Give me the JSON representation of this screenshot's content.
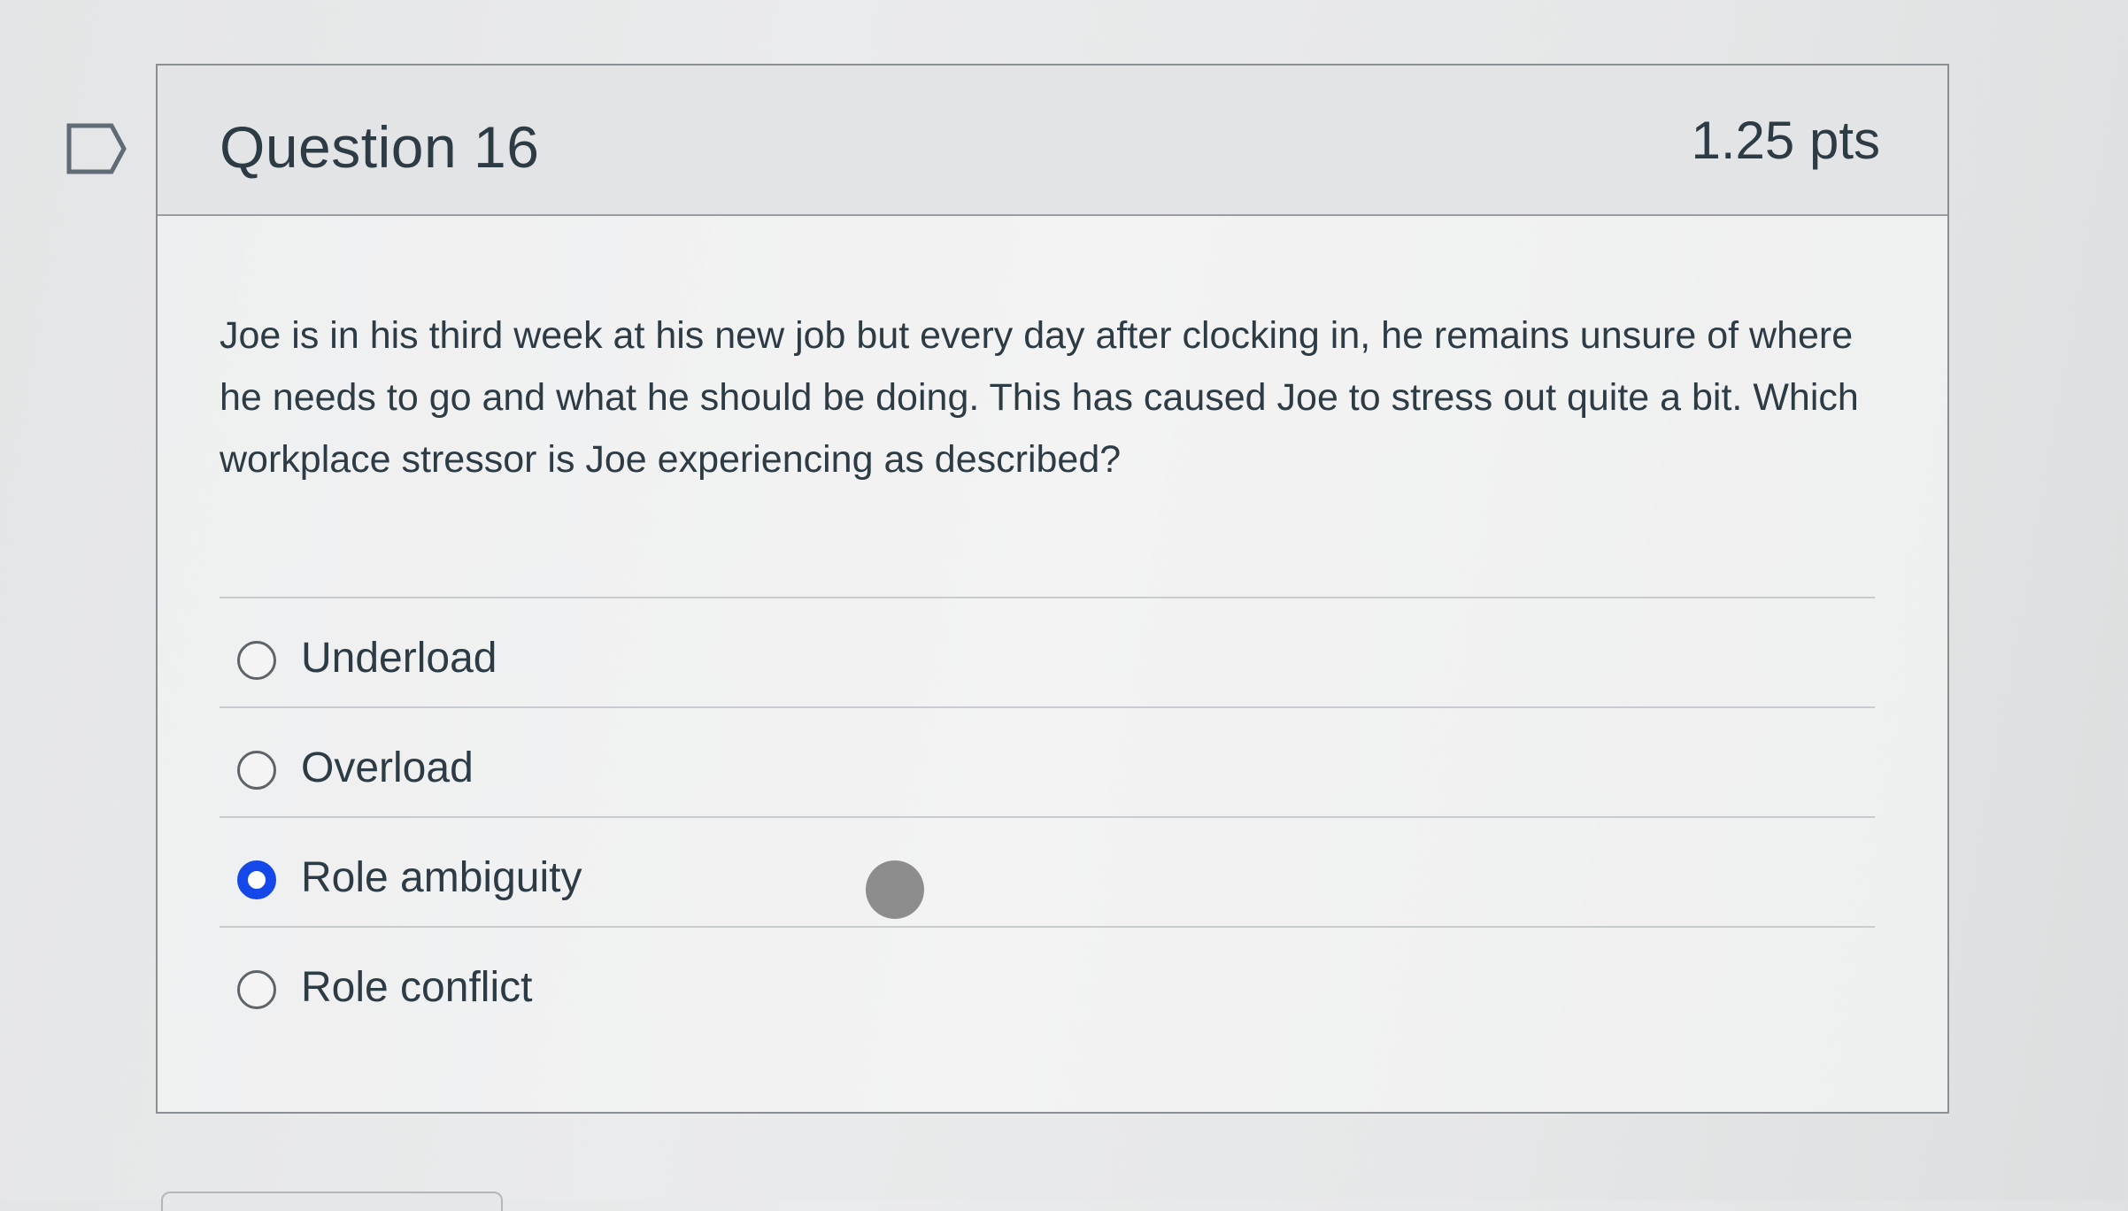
{
  "question": {
    "title": "Question 16",
    "points": "1.25 pts",
    "text": "Joe is in his third week at his new job but every day after clocking in, he remains unsure of where he needs to go and what he should be doing. This has caused Joe to stress out quite a bit. Which workplace stressor is Joe experiencing as described?",
    "flag_icon": "flag-question-icon"
  },
  "answers": [
    {
      "label": "Underload",
      "selected": false
    },
    {
      "label": "Overload",
      "selected": false
    },
    {
      "label": "Role ambiguity",
      "selected": true
    },
    {
      "label": "Role conflict",
      "selected": false
    }
  ],
  "colors": {
    "selected_radio": "#1448e8",
    "text": "#2d3b45",
    "header_bg": "#e3e4e5"
  }
}
